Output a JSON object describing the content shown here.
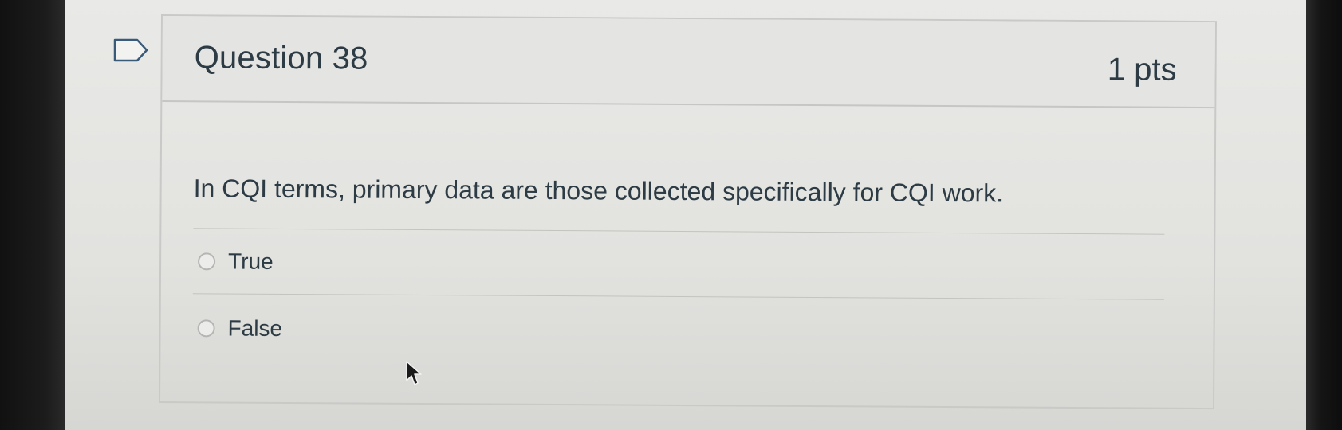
{
  "question": {
    "title": "Question 38",
    "points": "1 pts",
    "text": "In CQI terms, primary data are those collected specifically for CQI work.",
    "answers": [
      {
        "label": "True",
        "selected": false
      },
      {
        "label": "False",
        "selected": false
      }
    ]
  },
  "icons": {
    "flag": "flag-outline-icon",
    "cursor": "mouse-pointer-icon"
  },
  "colors": {
    "text": "#2d3b45",
    "border": "#c9c9c7",
    "header_bg": "#e4e4e2"
  }
}
